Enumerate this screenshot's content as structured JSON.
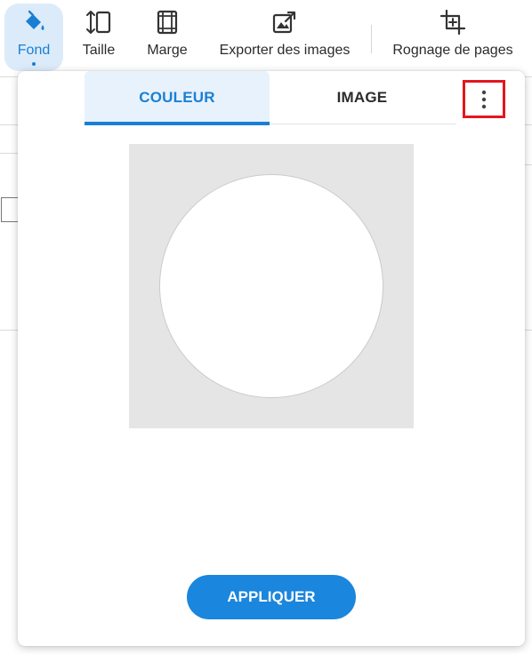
{
  "toolbar": {
    "items": [
      {
        "label": "Fond",
        "icon": "paint-bucket-icon"
      },
      {
        "label": "Taille",
        "icon": "resize-icon"
      },
      {
        "label": "Marge",
        "icon": "margin-icon"
      },
      {
        "label": "Exporter des images",
        "icon": "export-image-icon"
      },
      {
        "label": "Rognage de pages",
        "icon": "crop-icon"
      }
    ]
  },
  "panel": {
    "tabs": [
      {
        "label": "COULEUR",
        "selected": true
      },
      {
        "label": "IMAGE",
        "selected": false
      }
    ],
    "more_icon": "more-vertical-icon",
    "color_preview": "#ffffff",
    "apply_label": "APPLIQUER"
  },
  "colors": {
    "accent": "#1a7fd4",
    "accent_bg": "#e8f2fc",
    "highlight_box": "#e4161d",
    "apply_button": "#1a86dd"
  }
}
